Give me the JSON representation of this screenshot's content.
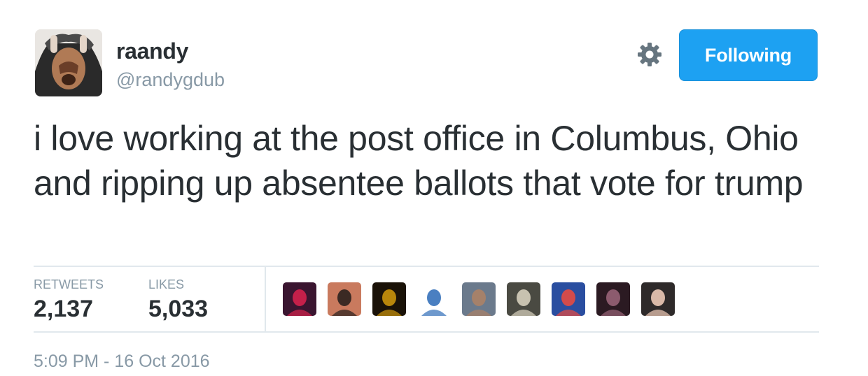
{
  "user": {
    "display_name": "raandy",
    "handle": "@randygdub"
  },
  "actions": {
    "follow_label": "Following",
    "settings_icon": "gear-icon"
  },
  "tweet": {
    "text": "i love working at the post office in Columbus, Ohio and ripping up absentee ballots that vote for trump",
    "timestamp": "5:09 PM - 16 Oct 2016"
  },
  "stats": {
    "retweets_label": "RETWEETS",
    "retweets_value": "2,137",
    "likes_label": "LIKES",
    "likes_value": "5,033"
  },
  "liker_avatars": [
    {
      "name": "liker-avatar-1",
      "colors": [
        "#3a1530",
        "#c4204a"
      ]
    },
    {
      "name": "liker-avatar-2",
      "colors": [
        "#c97a5e",
        "#3b2a24"
      ]
    },
    {
      "name": "liker-avatar-3",
      "colors": [
        "#1a1208",
        "#b8860b"
      ]
    },
    {
      "name": "liker-avatar-4",
      "colors": [
        "#ffffff",
        "#4a7fc1"
      ]
    },
    {
      "name": "liker-avatar-5",
      "colors": [
        "#6b7a8c",
        "#a5816a"
      ]
    },
    {
      "name": "liker-avatar-6",
      "colors": [
        "#4a4a42",
        "#c8c2b0"
      ]
    },
    {
      "name": "liker-avatar-7",
      "colors": [
        "#2a4ea0",
        "#d24b4b"
      ]
    },
    {
      "name": "liker-avatar-8",
      "colors": [
        "#2b1a22",
        "#8c5b6e"
      ]
    },
    {
      "name": "liker-avatar-9",
      "colors": [
        "#2e2a2a",
        "#d9b9a8"
      ]
    }
  ],
  "colors": {
    "accent": "#1da1f2",
    "text": "#292f33",
    "muted": "#8899a6",
    "divider": "#e1e8ed"
  }
}
